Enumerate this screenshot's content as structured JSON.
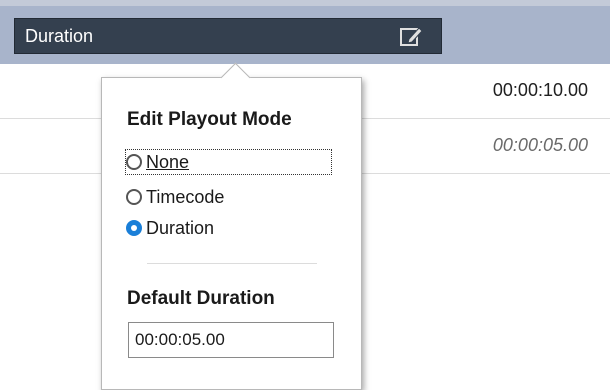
{
  "table": {
    "column_header": "Duration",
    "column_header_icon": "edit-icon",
    "rows": [
      {
        "value": "00:00:10.00",
        "italic": false
      },
      {
        "value": "00:00:05.00",
        "italic": true
      }
    ]
  },
  "popup": {
    "mode_heading": "Edit Playout Mode",
    "options": [
      {
        "label": "None",
        "selected": false,
        "focused": true
      },
      {
        "label": "Timecode",
        "selected": false,
        "focused": false
      },
      {
        "label": "Duration",
        "selected": true,
        "focused": false
      }
    ],
    "default_heading": "Default Duration",
    "default_duration_value": "00:00:05.00"
  },
  "colors": {
    "header_band": "#a8b4cb",
    "column_header": "#34404f",
    "radio_accent": "#1a7fd8"
  }
}
